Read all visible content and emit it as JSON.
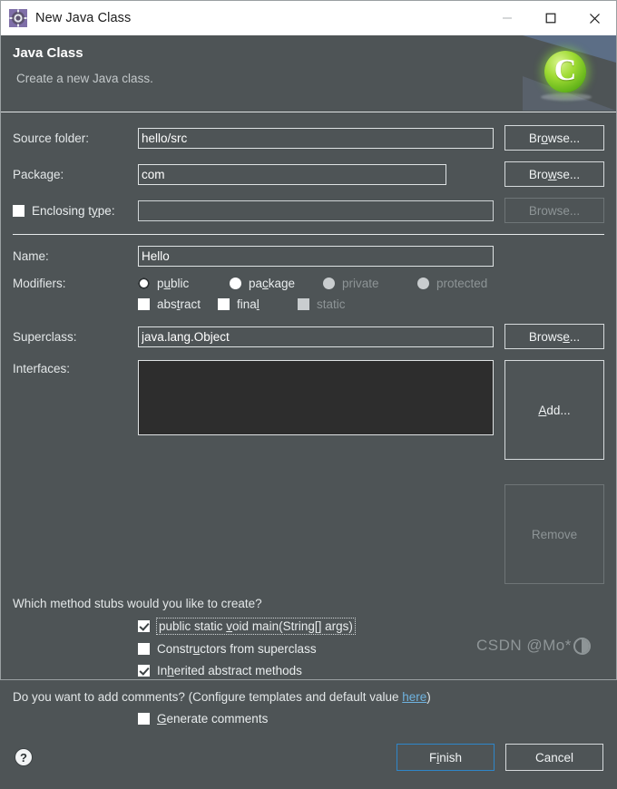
{
  "window": {
    "title": "New Java Class",
    "icon": "java-class-window-icon",
    "minimize_label": "—",
    "maximize_label": "□",
    "close_label": "✕"
  },
  "banner": {
    "title": "Java Class",
    "subtitle": "Create a new Java class.",
    "badge_letter": "C"
  },
  "form": {
    "source_folder": {
      "label": "Source folder:",
      "value": "hello/src",
      "browse": {
        "pre": "Br",
        "mnemonic": "o",
        "post": "wse..."
      }
    },
    "package": {
      "label": "Package:",
      "value": "com",
      "browse": {
        "pre": "Bro",
        "mnemonic": "w",
        "post": "se..."
      }
    },
    "enclosing_type": {
      "label_pre": "Enclosing t",
      "label_mnemonic": "y",
      "label_post": "pe:",
      "value": "",
      "checked": false,
      "browse": {
        "pre": "Br",
        "mnemonic": "o",
        "post": "wse..."
      },
      "disabled": true
    },
    "name": {
      "label": "Name:",
      "value": "Hello"
    },
    "modifiers": {
      "label": "Modifiers:",
      "radios": [
        {
          "name": "public",
          "pre": "p",
          "mnemonic": "u",
          "post": "blic",
          "selected": true,
          "disabled": false
        },
        {
          "name": "package",
          "pre": "pa",
          "mnemonic": "c",
          "post": "kage",
          "selected": false,
          "disabled": false
        },
        {
          "name": "private",
          "pre": "private",
          "mnemonic": "",
          "post": "",
          "selected": false,
          "disabled": true
        },
        {
          "name": "protected",
          "pre": "protected",
          "mnemonic": "",
          "post": "",
          "selected": false,
          "disabled": true
        }
      ],
      "checkboxes": [
        {
          "name": "abstract",
          "pre": "abs",
          "mnemonic": "t",
          "post": "ract",
          "checked": false,
          "disabled": false
        },
        {
          "name": "final",
          "pre": "fina",
          "mnemonic": "l",
          "post": "",
          "checked": false,
          "disabled": false
        },
        {
          "name": "static",
          "pre": "static",
          "mnemonic": "",
          "post": "",
          "checked": false,
          "disabled": true
        }
      ]
    },
    "superclass": {
      "label": "Superclass:",
      "value": "java.lang.Object",
      "browse": {
        "pre": "Brows",
        "mnemonic": "e",
        "post": "..."
      }
    },
    "interfaces": {
      "label": "Interfaces:",
      "items": [],
      "add": {
        "pre": "",
        "mnemonic": "A",
        "post": "dd..."
      },
      "remove": {
        "pre": "Remove",
        "mnemonic": "",
        "post": ""
      },
      "remove_disabled": true
    },
    "stubs": {
      "question": "Which method stubs would you like to create?",
      "items": [
        {
          "name": "main-method",
          "pre": "public static ",
          "mnemonic": "v",
          "post": "oid main(String[] args)",
          "checked": true,
          "focused": true
        },
        {
          "name": "constructors-from-superclass",
          "pre": "Constr",
          "mnemonic": "u",
          "post": "ctors from superclass",
          "checked": false,
          "focused": false
        },
        {
          "name": "inherited-abstract-methods",
          "pre": "In",
          "mnemonic": "h",
          "post": "erited abstract methods",
          "checked": true,
          "focused": false
        }
      ]
    },
    "comments": {
      "question_pre": "Do you want to add comments? (Configure templates and default value ",
      "link": "here",
      "question_post": ")",
      "checkbox": {
        "name": "generate-comments",
        "pre": "",
        "mnemonic": "G",
        "post": "enerate comments",
        "checked": false
      }
    }
  },
  "footer": {
    "help_icon": "help-icon",
    "finish": {
      "pre": "F",
      "mnemonic": "i",
      "post": "nish"
    },
    "cancel": {
      "pre": "Cancel",
      "mnemonic": "",
      "post": ""
    }
  },
  "watermark": {
    "text": "CSDN @Mo*"
  },
  "colors": {
    "dialog_bg": "#4e5456",
    "titlebar_bg": "#ffffff",
    "field_border": "#dfe3e4",
    "list_bg": "#2d2d2d",
    "link": "#6fb3e0",
    "primary_border": "#2f86c9",
    "badge_green": "#8ed62e"
  }
}
